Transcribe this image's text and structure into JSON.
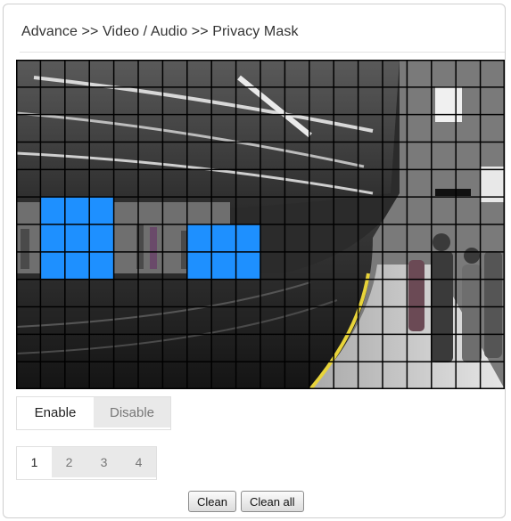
{
  "breadcrumb": "Advance >> Video / Audio >> Privacy Mask",
  "video": {
    "grid_columns": 20,
    "grid_rows": 12,
    "mask_color": "#1E90FF",
    "masked_cells": [
      [
        1,
        5
      ],
      [
        2,
        5
      ],
      [
        3,
        5
      ],
      [
        1,
        6
      ],
      [
        2,
        6
      ],
      [
        3,
        6
      ],
      [
        1,
        7
      ],
      [
        2,
        7
      ],
      [
        3,
        7
      ],
      [
        7,
        6
      ],
      [
        8,
        6
      ],
      [
        9,
        6
      ],
      [
        7,
        7
      ],
      [
        8,
        7
      ],
      [
        9,
        7
      ]
    ]
  },
  "mask_toggle": {
    "enable_label": "Enable",
    "disable_label": "Disable",
    "selected": "Enable"
  },
  "regions": {
    "items": [
      "1",
      "2",
      "3",
      "4"
    ],
    "selected": "1"
  },
  "actions": {
    "clean_label": "Clean",
    "clean_all_label": "Clean all"
  }
}
